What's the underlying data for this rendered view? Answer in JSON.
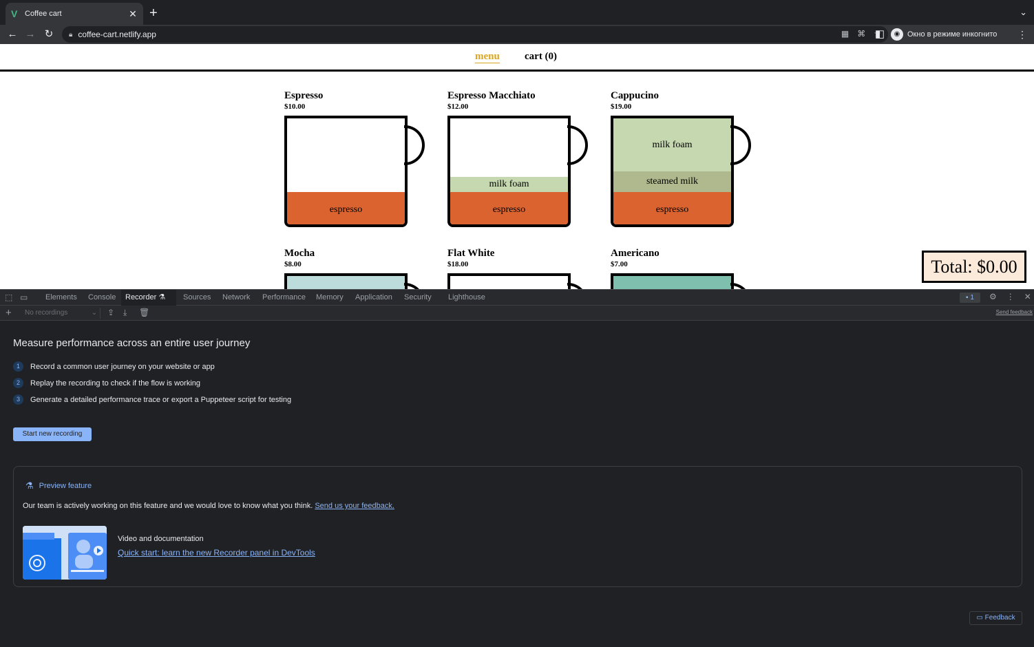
{
  "browser": {
    "tab_title": "Coffee cart",
    "tab_favicon": "V",
    "close_glyph": "✕",
    "new_tab_glyph": "+",
    "tab_search_glyph": "⌄",
    "url": "coffee-cart.netlify.app",
    "incognito_label": "Окно в режиме инкогнито"
  },
  "site": {
    "nav": {
      "menu": "menu",
      "cart": "cart (0)"
    },
    "products": [
      {
        "name": "Espresso",
        "price": "$10.00",
        "layers": [
          "espresso"
        ]
      },
      {
        "name": "Espresso Macchiato",
        "price": "$12.00",
        "layers": [
          "milk foam",
          "espresso"
        ]
      },
      {
        "name": "Cappucino",
        "price": "$19.00",
        "layers": [
          "milk foam",
          "steamed milk",
          "espresso"
        ]
      },
      {
        "name": "Mocha",
        "price": "$8.00"
      },
      {
        "name": "Flat White",
        "price": "$18.00"
      },
      {
        "name": "Americano",
        "price": "$7.00"
      }
    ],
    "total": "Total: $0.00",
    "colors": {
      "espresso": "#da6330",
      "milk_foam": "#c6d8b0",
      "steamed_milk": "#b0b98e",
      "nav_active": "#daa520",
      "total_bg": "#fbe9d9"
    }
  },
  "devtools": {
    "tabs": [
      "Elements",
      "Console",
      "Recorder",
      "Sources",
      "Network",
      "Performance",
      "Memory",
      "Application",
      "Security",
      "Lighthouse"
    ],
    "active_tab": "Recorder",
    "issues_count": "1",
    "recordings_placeholder": "No recordings",
    "send_feedback": "Send feedback",
    "landing_title": "Measure performance across an entire user journey",
    "steps": [
      {
        "num": "1",
        "text": "Record a common user journey on your website or app"
      },
      {
        "num": "2",
        "text": "Replay the recording to check if the flow is working"
      },
      {
        "num": "3",
        "text": "Generate a detailed performance trace or export a Puppeteer script for testing"
      }
    ],
    "start_button": "Start new recording",
    "preview": {
      "label": "Preview feature",
      "description": "Our team is actively working on this feature and we would love to know what you think.",
      "feedback_link": "Send us your feedback.",
      "doc_title": "Video and documentation",
      "doc_link": "Quick start: learn the new Recorder panel in DevTools"
    },
    "feedback_button": "Feedback",
    "accent": "#8ab4f8"
  }
}
